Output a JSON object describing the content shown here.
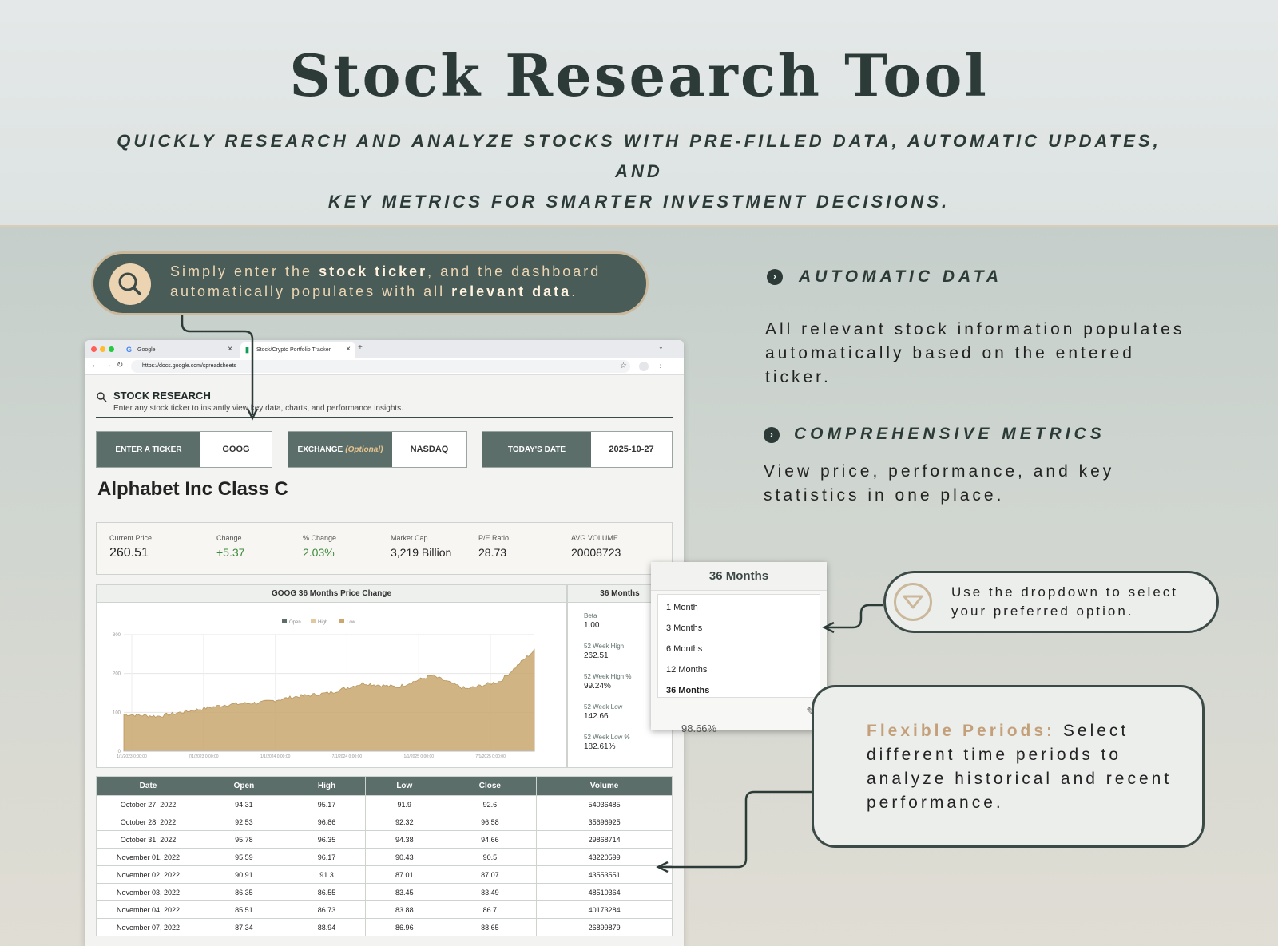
{
  "hero": {
    "title": "Stock Research Tool",
    "subtitle_line1": "QUICKLY RESEARCH AND ANALYZE STOCKS WITH PRE-FILLED DATA, AUTOMATIC UPDATES, AND",
    "subtitle_line2": "KEY METRICS FOR SMARTER INVESTMENT DECISIONS."
  },
  "pill": {
    "p1": "Simply enter the ",
    "b1": "stock ticker",
    "p2": ", and the dashboard automatically populates with all ",
    "b2": "relevant data",
    "p3": "."
  },
  "browser": {
    "tab1": "Google",
    "tab2": "Stock/Crypto Portfolio Tracker",
    "new_tab": "+",
    "url": "https://docs.google.com/spreadsheets"
  },
  "research": {
    "title": "STOCK RESEARCH",
    "desc": "Enter any stock ticker to instantly view key data, charts, and performance insights."
  },
  "controls": {
    "ticker_label": "ENTER A TICKER",
    "ticker_value": "GOOG",
    "exchange_label": "EXCHANGE",
    "exchange_optional": "(Optional)",
    "exchange_value": "NASDAQ",
    "date_label": "TODAY'S DATE",
    "date_value": "2025-10-27"
  },
  "company": "Alphabet Inc Class C",
  "stats": {
    "current_price_label": "Current Price",
    "current_price": "260.51",
    "change_label": "Change",
    "change": "+5.37",
    "pct_change_label": "% Change",
    "pct_change": "2.03%",
    "market_cap_label": "Market Cap",
    "market_cap": "3,219 Billion",
    "pe_label": "P/E Ratio",
    "pe": "28.73",
    "avg_vol_label": "AVG VOLUME",
    "avg_vol": "20008723"
  },
  "metrics": {
    "header": "36 Months",
    "beta_label": "Beta",
    "beta": "1.00",
    "wk_high_label": "52 Week High",
    "wk_high": "262.51",
    "wk_high_pct_label": "52 Week High %",
    "wk_high_pct": "99.24%",
    "wk_low_label": "52 Week Low",
    "wk_low": "142.66",
    "wk_low_pct_label": "52 Week Low %",
    "wk_low_pct": "182.61%"
  },
  "chart_data": {
    "type": "area",
    "title": "GOOG 36 Months Price Change",
    "legend": [
      "Open",
      "High",
      "Low"
    ],
    "legend_colors": [
      "#5b6e6a",
      "#e3c7a0",
      "#c9a76e"
    ],
    "yticks": [
      "0",
      "100",
      "200",
      "300"
    ],
    "ylim": [
      0,
      300
    ],
    "xticks": [
      "1/1/2023 0:00:00",
      "7/1/2023 0:00:00",
      "1/1/2024 0:00:00",
      "7/1/2024 0:00:00",
      "1/1/2025 0:00:00",
      "7/1/2025 0:00:00"
    ],
    "x": [
      "2022-10",
      "2023-01",
      "2023-04",
      "2023-07",
      "2023-10",
      "2024-01",
      "2024-04",
      "2024-07",
      "2024-10",
      "2025-01",
      "2025-04",
      "2025-07",
      "2025-10"
    ],
    "values": [
      95,
      90,
      105,
      120,
      125,
      140,
      150,
      175,
      165,
      195,
      160,
      180,
      260
    ]
  },
  "table": {
    "headers": [
      "Date",
      "Open",
      "High",
      "Low",
      "Close",
      "Volume"
    ],
    "rows": [
      [
        "October 27,  2022",
        "94.31",
        "95.17",
        "91.9",
        "92.6",
        "54036485"
      ],
      [
        "October 28,  2022",
        "92.53",
        "96.86",
        "92.32",
        "96.58",
        "35696925"
      ],
      [
        "October 31,  2022",
        "95.78",
        "96.35",
        "94.38",
        "94.66",
        "29868714"
      ],
      [
        "November 01,  2022",
        "95.59",
        "96.17",
        "90.43",
        "90.5",
        "43220599"
      ],
      [
        "November 02,  2022",
        "90.91",
        "91.3",
        "87.01",
        "87.07",
        "43553551"
      ],
      [
        "November 03,  2022",
        "86.35",
        "86.55",
        "83.45",
        "83.49",
        "48510364"
      ],
      [
        "November 04,  2022",
        "85.51",
        "86.73",
        "83.88",
        "86.7",
        "40173284"
      ],
      [
        "November 07,  2022",
        "87.34",
        "88.94",
        "86.96",
        "88.65",
        "26899879"
      ]
    ]
  },
  "dropdown": {
    "selected": "36 Months",
    "options": [
      "1 Month",
      "3 Months",
      "6 Months",
      "12 Months",
      "36 Months"
    ],
    "peek": "98.66%"
  },
  "features": {
    "auto_title": "AUTOMATIC DATA",
    "auto_body": "All relevant stock information populates automatically based on the entered ticker.",
    "comp_title": "COMPREHENSIVE METRICS",
    "comp_body": "View price, performance, and key statistics in one place."
  },
  "callout_dropdown": "Use the dropdown to select your preferred option.",
  "callout_periods": {
    "highlight": "Flexible Periods:",
    "body": " Select different time periods to analyze historical and recent performance."
  },
  "colors": {
    "dark": "#2c3b37",
    "slate": "#5b6e6a",
    "tan": "#cbb89a",
    "gain": "#3d8a3d"
  }
}
